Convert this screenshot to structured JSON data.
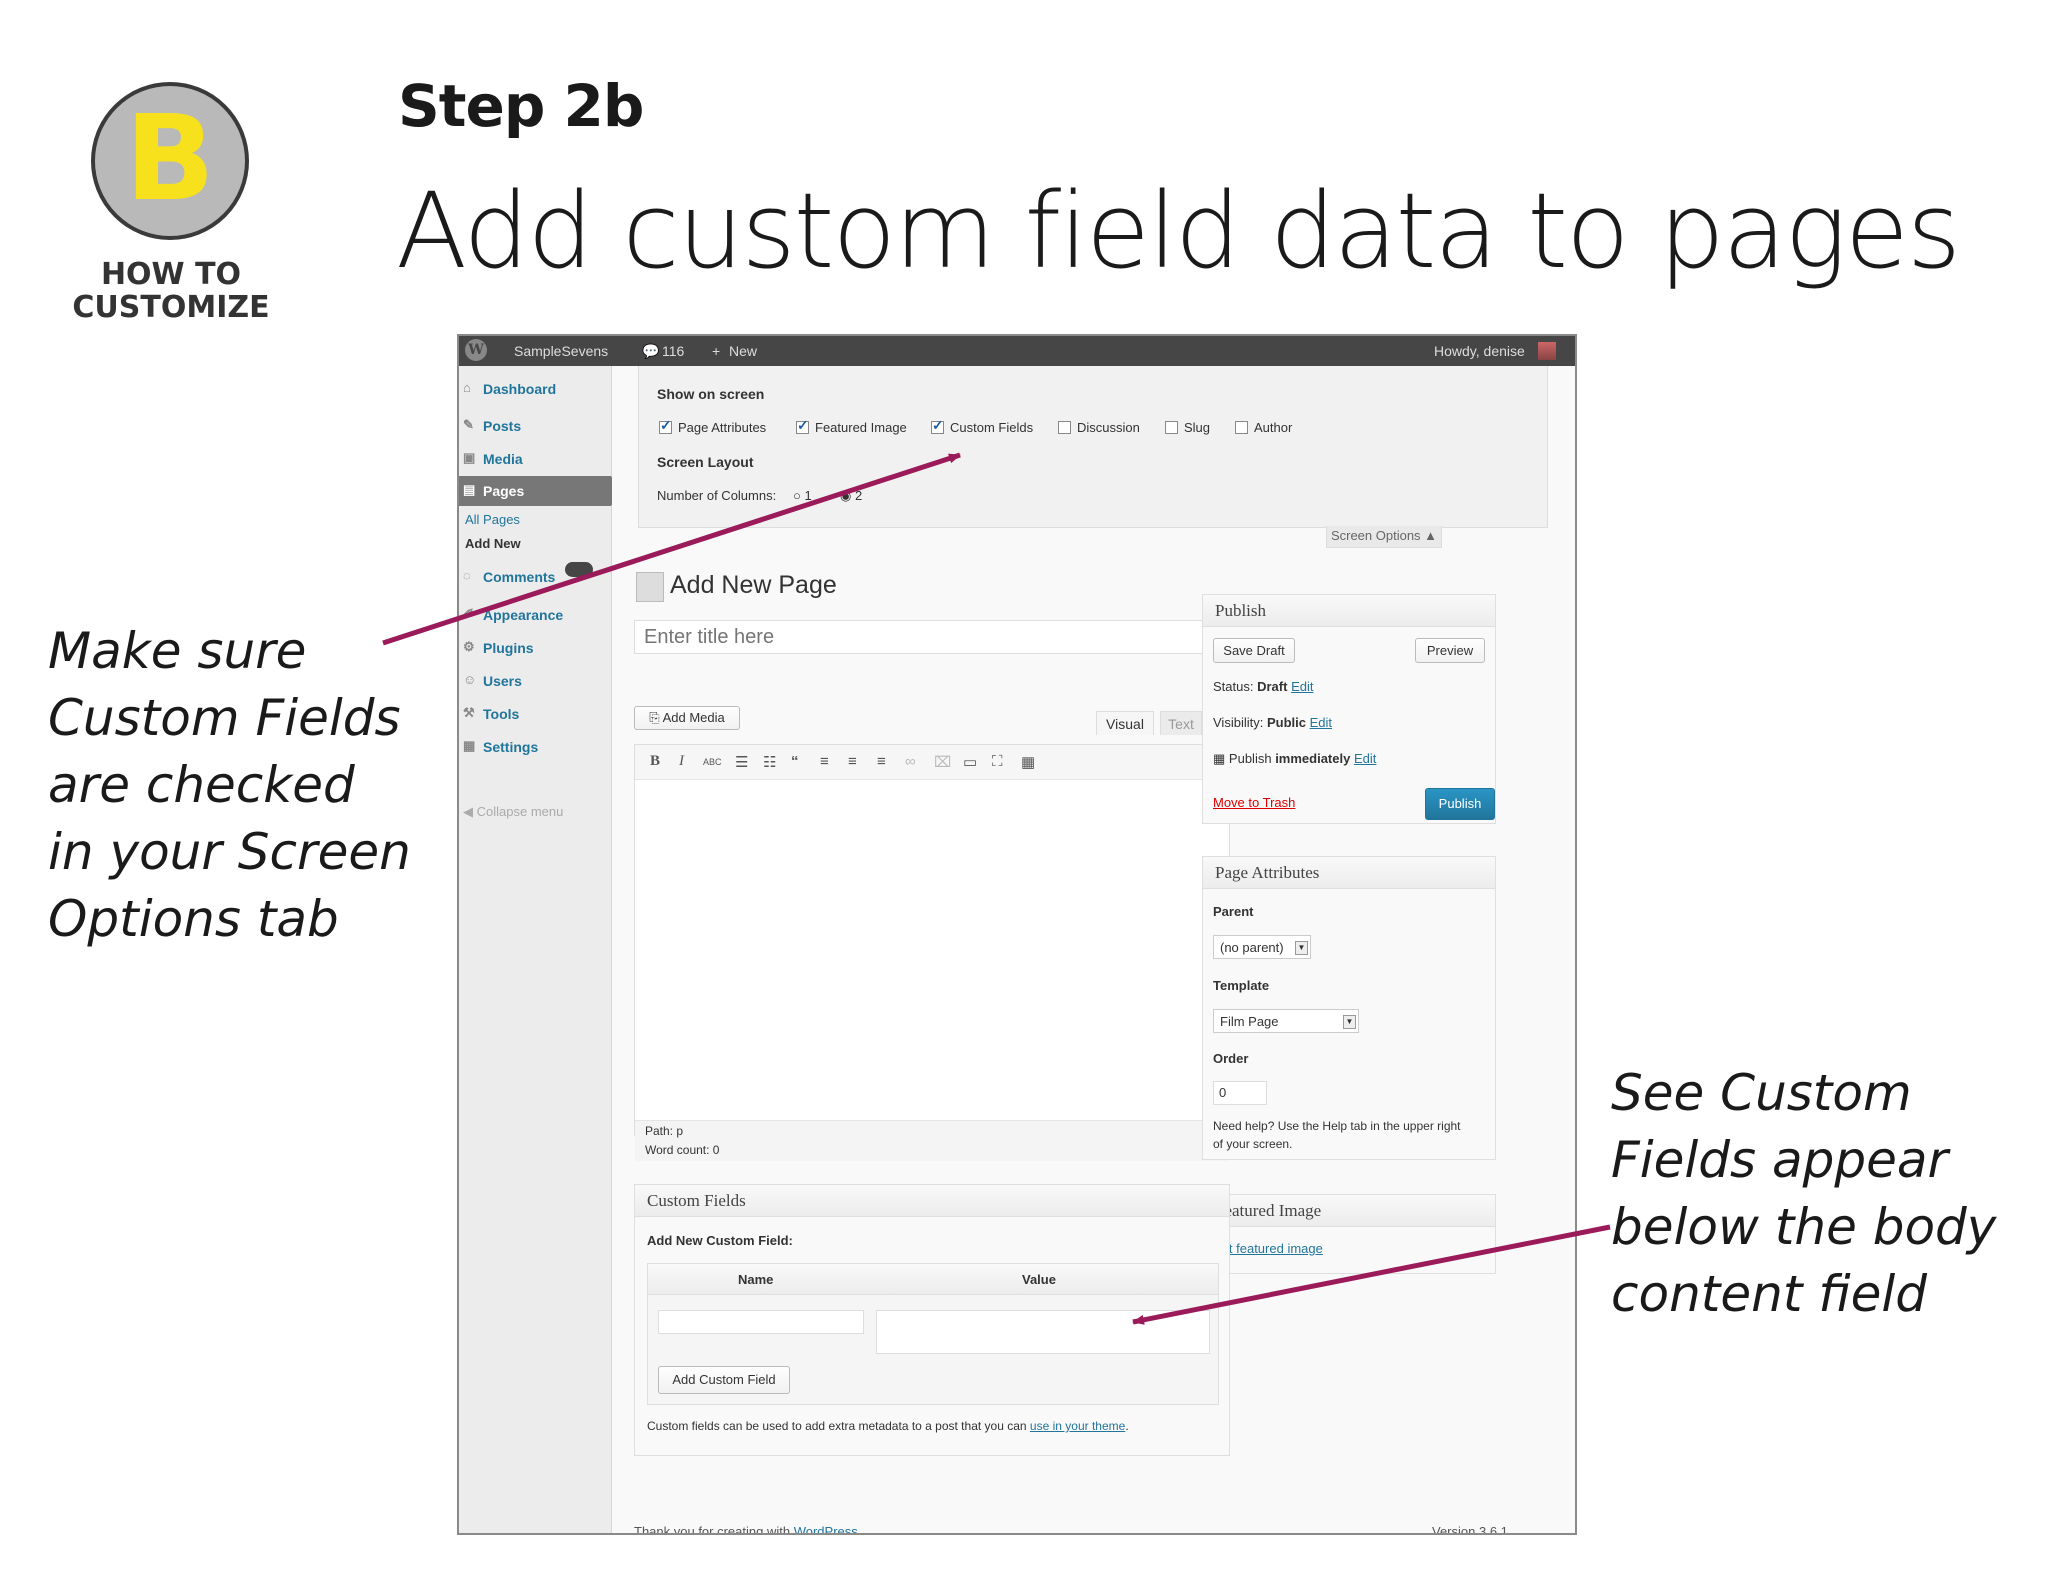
{
  "badge": {
    "letter": "B",
    "caption_line1": "HOW TO",
    "caption_line2": "CUSTOMIZE"
  },
  "step": "Step 2b",
  "title": "Add custom field data to pages",
  "note_left": [
    "Make sure",
    "Custom Fields",
    "are checked",
    "in your Screen",
    "Options tab"
  ],
  "note_right": [
    "See Custom",
    "Fields appear",
    "below the body",
    "content field"
  ],
  "arrow_color": "#9b1b5a",
  "adminbar": {
    "site": "SampleSevens",
    "comments": "116",
    "new": "New",
    "howdy": "Howdy, denise"
  },
  "sidebar": {
    "items": [
      {
        "label": "Dashboard",
        "icon": "home-icon"
      },
      {
        "label": "Posts",
        "icon": "pin-icon"
      },
      {
        "label": "Media",
        "icon": "media-icon"
      },
      {
        "label": "Pages",
        "icon": "pages-icon"
      },
      {
        "label": "Comments",
        "icon": "comment-icon"
      },
      {
        "label": "Appearance",
        "icon": "brush-icon"
      },
      {
        "label": "Plugins",
        "icon": "plugin-icon"
      },
      {
        "label": "Users",
        "icon": "users-icon"
      },
      {
        "label": "Tools",
        "icon": "tools-icon"
      },
      {
        "label": "Settings",
        "icon": "settings-icon"
      }
    ],
    "sub_all_pages": "All Pages",
    "sub_add_new": "Add New",
    "collapse": "Collapse menu"
  },
  "screen_options": {
    "heading": "Show on screen",
    "checkboxes": [
      {
        "label": "Page Attributes",
        "checked": true
      },
      {
        "label": "Featured Image",
        "checked": true
      },
      {
        "label": "Custom Fields",
        "checked": true
      },
      {
        "label": "Discussion",
        "checked": false
      },
      {
        "label": "Slug",
        "checked": false
      },
      {
        "label": "Author",
        "checked": false
      }
    ],
    "layout_heading": "Screen Layout",
    "columns_label": "Number of Columns:",
    "col1": "1",
    "col2": "2",
    "tab": "Screen Options"
  },
  "editor": {
    "page_title": "Add New Page",
    "title_placeholder": "Enter title here",
    "add_media": "Add Media",
    "tab_visual": "Visual",
    "tab_text": "Text",
    "path": "Path: p",
    "word_count": "Word count: 0"
  },
  "publish": {
    "heading": "Publish",
    "save_draft": "Save Draft",
    "preview": "Preview",
    "status_label": "Status:",
    "status_value": "Draft",
    "visibility_label": "Visibility:",
    "visibility_value": "Public",
    "schedule_label": "Publish",
    "schedule_value": "immediately",
    "edit": "Edit",
    "trash": "Move to Trash",
    "publish_btn": "Publish"
  },
  "attributes": {
    "heading": "Page Attributes",
    "parent_label": "Parent",
    "parent_value": "(no parent)",
    "template_label": "Template",
    "template_value": "Film Page",
    "order_label": "Order",
    "order_value": "0",
    "help1": "Need help? Use the Help tab in the upper right",
    "help2": "of your screen."
  },
  "featured": {
    "heading": "Featured Image",
    "link": "Set featured image"
  },
  "custom_fields": {
    "heading": "Custom Fields",
    "add_new": "Add New Custom Field:",
    "col_name": "Name",
    "col_value": "Value",
    "add_btn": "Add Custom Field",
    "note_prefix": "Custom fields can be used to add extra metadata to a post that you can",
    "note_link": "use in your theme"
  },
  "footer": {
    "prefix": "Thank you for creating with",
    "link": "WordPress",
    "version": "Version 3.6.1"
  }
}
